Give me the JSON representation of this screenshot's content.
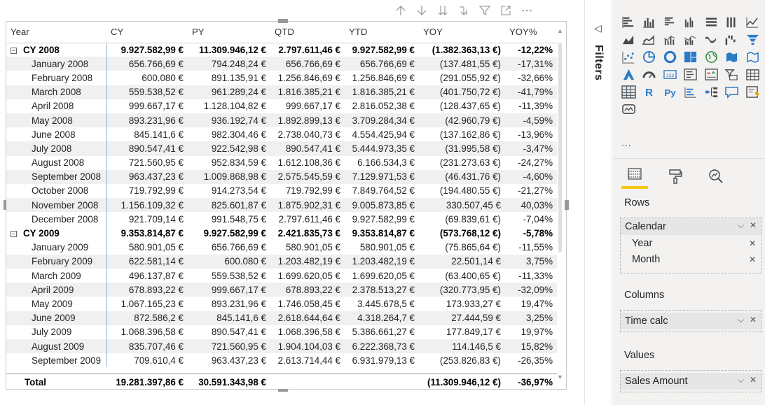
{
  "toolbar": {
    "icons": [
      "sort-asc-icon",
      "sort-desc-icon",
      "expand-all-icon",
      "drill-down-icon",
      "filter-icon",
      "focus-mode-icon",
      "more-options-icon"
    ]
  },
  "table": {
    "headers": [
      "Year",
      "CY",
      "PY",
      "QTD",
      "YTD",
      "YOY",
      "YOY%"
    ],
    "rows": [
      {
        "type": "year",
        "label": "CY 2008",
        "vals": [
          "9.927.582,99 €",
          "11.309.946,12 €",
          "2.797.611,46 €",
          "9.927.582,99 €",
          "(1.382.363,13 €)",
          "-12,22%"
        ]
      },
      {
        "type": "month",
        "label": "January 2008",
        "vals": [
          "656.766,69 €",
          "794.248,24 €",
          "656.766,69 €",
          "656.766,69 €",
          "(137.481,55 €)",
          "-17,31%"
        ]
      },
      {
        "type": "month",
        "label": "February 2008",
        "vals": [
          "600.080 €",
          "891.135,91 €",
          "1.256.846,69 €",
          "1.256.846,69 €",
          "(291.055,92 €)",
          "-32,66%"
        ]
      },
      {
        "type": "month",
        "label": "March 2008",
        "vals": [
          "559.538,52 €",
          "961.289,24 €",
          "1.816.385,21 €",
          "1.816.385,21 €",
          "(401.750,72 €)",
          "-41,79%"
        ]
      },
      {
        "type": "month",
        "label": "April 2008",
        "vals": [
          "999.667,17 €",
          "1.128.104,82 €",
          "999.667,17 €",
          "2.816.052,38 €",
          "(128.437,65 €)",
          "-11,39%"
        ]
      },
      {
        "type": "month",
        "label": "May 2008",
        "vals": [
          "893.231,96 €",
          "936.192,74 €",
          "1.892.899,13 €",
          "3.709.284,34 €",
          "(42.960,79 €)",
          "-4,59%"
        ]
      },
      {
        "type": "month",
        "label": "June 2008",
        "vals": [
          "845.141,6 €",
          "982.304,46 €",
          "2.738.040,73 €",
          "4.554.425,94 €",
          "(137.162,86 €)",
          "-13,96%"
        ]
      },
      {
        "type": "month",
        "label": "July 2008",
        "vals": [
          "890.547,41 €",
          "922.542,98 €",
          "890.547,41 €",
          "5.444.973,35 €",
          "(31.995,58 €)",
          "-3,47%"
        ]
      },
      {
        "type": "month",
        "label": "August 2008",
        "vals": [
          "721.560,95 €",
          "952.834,59 €",
          "1.612.108,36 €",
          "6.166.534,3 €",
          "(231.273,63 €)",
          "-24,27%"
        ]
      },
      {
        "type": "month",
        "label": "September 2008",
        "vals": [
          "963.437,23 €",
          "1.009.868,98 €",
          "2.575.545,59 €",
          "7.129.971,53 €",
          "(46.431,76 €)",
          "-4,60%"
        ]
      },
      {
        "type": "month",
        "label": "October 2008",
        "vals": [
          "719.792,99 €",
          "914.273,54 €",
          "719.792,99 €",
          "7.849.764,52 €",
          "(194.480,55 €)",
          "-21,27%"
        ]
      },
      {
        "type": "month",
        "label": "November 2008",
        "vals": [
          "1.156.109,32 €",
          "825.601,87 €",
          "1.875.902,31 €",
          "9.005.873,85 €",
          "330.507,45 €",
          "40,03%"
        ]
      },
      {
        "type": "month",
        "label": "December 2008",
        "vals": [
          "921.709,14 €",
          "991.548,75 €",
          "2.797.611,46 €",
          "9.927.582,99 €",
          "(69.839,61 €)",
          "-7,04%"
        ]
      },
      {
        "type": "year",
        "label": "CY 2009",
        "vals": [
          "9.353.814,87 €",
          "9.927.582,99 €",
          "2.421.835,73 €",
          "9.353.814,87 €",
          "(573.768,12 €)",
          "-5,78%"
        ]
      },
      {
        "type": "month",
        "label": "January 2009",
        "vals": [
          "580.901,05 €",
          "656.766,69 €",
          "580.901,05 €",
          "580.901,05 €",
          "(75.865,64 €)",
          "-11,55%"
        ]
      },
      {
        "type": "month",
        "label": "February 2009",
        "vals": [
          "622.581,14 €",
          "600.080 €",
          "1.203.482,19 €",
          "1.203.482,19 €",
          "22.501,14 €",
          "3,75%"
        ]
      },
      {
        "type": "month",
        "label": "March 2009",
        "vals": [
          "496.137,87 €",
          "559.538,52 €",
          "1.699.620,05 €",
          "1.699.620,05 €",
          "(63.400,65 €)",
          "-11,33%"
        ]
      },
      {
        "type": "month",
        "label": "April 2009",
        "vals": [
          "678.893,22 €",
          "999.667,17 €",
          "678.893,22 €",
          "2.378.513,27 €",
          "(320.773,95 €)",
          "-32,09%"
        ]
      },
      {
        "type": "month",
        "label": "May 2009",
        "vals": [
          "1.067.165,23 €",
          "893.231,96 €",
          "1.746.058,45 €",
          "3.445.678,5 €",
          "173.933,27 €",
          "19,47%"
        ]
      },
      {
        "type": "month",
        "label": "June 2009",
        "vals": [
          "872.586,2 €",
          "845.141,6 €",
          "2.618.644,64 €",
          "4.318.264,7 €",
          "27.444,59 €",
          "3,25%"
        ]
      },
      {
        "type": "month",
        "label": "July 2009",
        "vals": [
          "1.068.396,58 €",
          "890.547,41 €",
          "1.068.396,58 €",
          "5.386.661,27 €",
          "177.849,17 €",
          "19,97%"
        ]
      },
      {
        "type": "month",
        "label": "August 2009",
        "vals": [
          "835.707,46 €",
          "721.560,95 €",
          "1.904.104,03 €",
          "6.222.368,73 €",
          "114.146,5 €",
          "15,82%"
        ]
      },
      {
        "type": "month",
        "label": "September 2009",
        "vals": [
          "709.610,4 €",
          "963.437,23 €",
          "2.613.714,44 €",
          "6.931.979,13 €",
          "(253.826,83 €)",
          "-26,35%"
        ]
      }
    ],
    "total": {
      "label": "Total",
      "vals": [
        "19.281.397,86 €",
        "30.591.343,98 €",
        "",
        "",
        "(11.309.946,12 €)",
        "-36,97%"
      ]
    }
  },
  "filters": {
    "label": "Filters"
  },
  "viz": {
    "more": "...",
    "tabs": [
      "fields-tab",
      "format-tab",
      "analytics-tab"
    ]
  },
  "wells": {
    "rows_label": "Rows",
    "rows_field": "Calendar",
    "rows_subs": [
      "Year",
      "Month"
    ],
    "columns_label": "Columns",
    "columns_field": "Time calc",
    "values_label": "Values",
    "values_field": "Sales Amount"
  }
}
